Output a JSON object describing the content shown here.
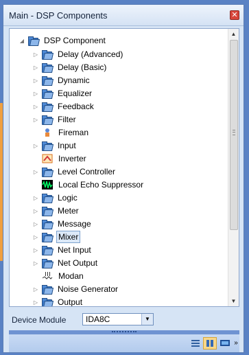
{
  "window": {
    "title": "Main - DSP Components",
    "close_label": "✕"
  },
  "tree": {
    "root_label": "DSP Component",
    "items": [
      {
        "label": "Delay (Advanced)",
        "kind": "folder",
        "expandable": true
      },
      {
        "label": "Delay (Basic)",
        "kind": "folder",
        "expandable": true
      },
      {
        "label": "Dynamic",
        "kind": "folder",
        "expandable": true
      },
      {
        "label": "Equalizer",
        "kind": "folder",
        "expandable": true
      },
      {
        "label": "Feedback",
        "kind": "folder",
        "expandable": true
      },
      {
        "label": "Filter",
        "kind": "folder",
        "expandable": true
      },
      {
        "label": "Fireman",
        "kind": "leaf",
        "icon": "fireman-icon"
      },
      {
        "label": "Input",
        "kind": "folder",
        "expandable": true
      },
      {
        "label": "Inverter",
        "kind": "leaf",
        "icon": "inverter-icon"
      },
      {
        "label": "Level Controller",
        "kind": "folder",
        "expandable": true
      },
      {
        "label": "Local Echo Suppressor",
        "kind": "leaf",
        "icon": "waveform-icon"
      },
      {
        "label": "Logic",
        "kind": "folder",
        "expandable": true
      },
      {
        "label": "Meter",
        "kind": "folder",
        "expandable": true
      },
      {
        "label": "Message",
        "kind": "folder",
        "expandable": true
      },
      {
        "label": "Mixer",
        "kind": "folder",
        "expandable": true,
        "selected": true
      },
      {
        "label": "Net Input",
        "kind": "folder",
        "expandable": true
      },
      {
        "label": "Net Output",
        "kind": "folder",
        "expandable": true
      },
      {
        "label": "Modan",
        "kind": "leaf",
        "icon": "modan-icon"
      },
      {
        "label": "Noise Generator",
        "kind": "folder",
        "expandable": true
      },
      {
        "label": "Output",
        "kind": "folder",
        "expandable": true
      }
    ]
  },
  "device_module": {
    "label": "Device Module",
    "value": "IDA8C"
  },
  "toolbar": {
    "tools": [
      {
        "icon": "list-view-icon"
      },
      {
        "icon": "split-view-icon",
        "active": true
      },
      {
        "icon": "monitor-icon"
      },
      {
        "icon": "overflow-chevron-icon"
      }
    ]
  },
  "colors": {
    "accent": "#f0a040",
    "panel": "#d6e4f5",
    "selection": "#dce9f8",
    "frame": "#5a82c4"
  }
}
